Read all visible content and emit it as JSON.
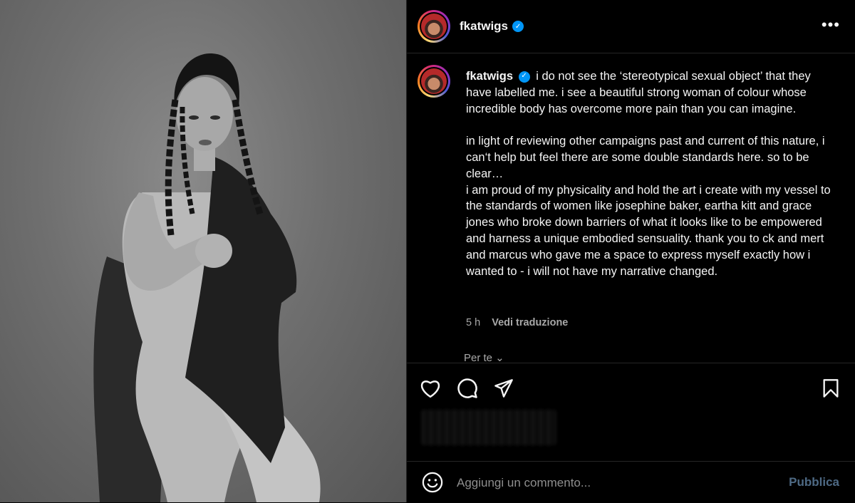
{
  "post": {
    "username": "fkatwigs",
    "verified_glyph": "✓",
    "more_glyph": "•••"
  },
  "caption": {
    "username": "fkatwigs",
    "paragraph1": "i do not see the ‘stereotypical sexual object’ that they have labelled me. i see a beautiful strong woman of colour whose incredible body has overcome more pain than you can imagine.",
    "paragraph2": "in light of reviewing other campaigns past and current of this nature, i can‘t help but feel there are some double standards here. so to be clear…",
    "paragraph3": "i am proud of my physicality and hold the art i create with my vessel to the standards of women like josephine baker, eartha kitt and grace jones who broke down barriers of what it looks like to be empowered and harness a unique embodied sensuality. thank you to ck and mert and marcus who gave me a space to express myself exactly how i wanted to - i will not have my narrative changed.",
    "time": "5 h",
    "translate": "Vedi traduzione",
    "truncated": "Per te ⌄"
  },
  "actions": {
    "icons": [
      "heart-icon",
      "comment-icon",
      "share-icon",
      "bookmark-icon"
    ]
  },
  "comment_box": {
    "placeholder": "Aggiungi un commento...",
    "publish": "Pubblica",
    "emoji_icon": "smiley-icon"
  },
  "colors": {
    "background": "#000000",
    "text": "#f5f5f5",
    "muted": "#a8a8a8",
    "verified": "#0095f6",
    "publish_disabled": "#4e6a85",
    "divider": "#262626"
  }
}
